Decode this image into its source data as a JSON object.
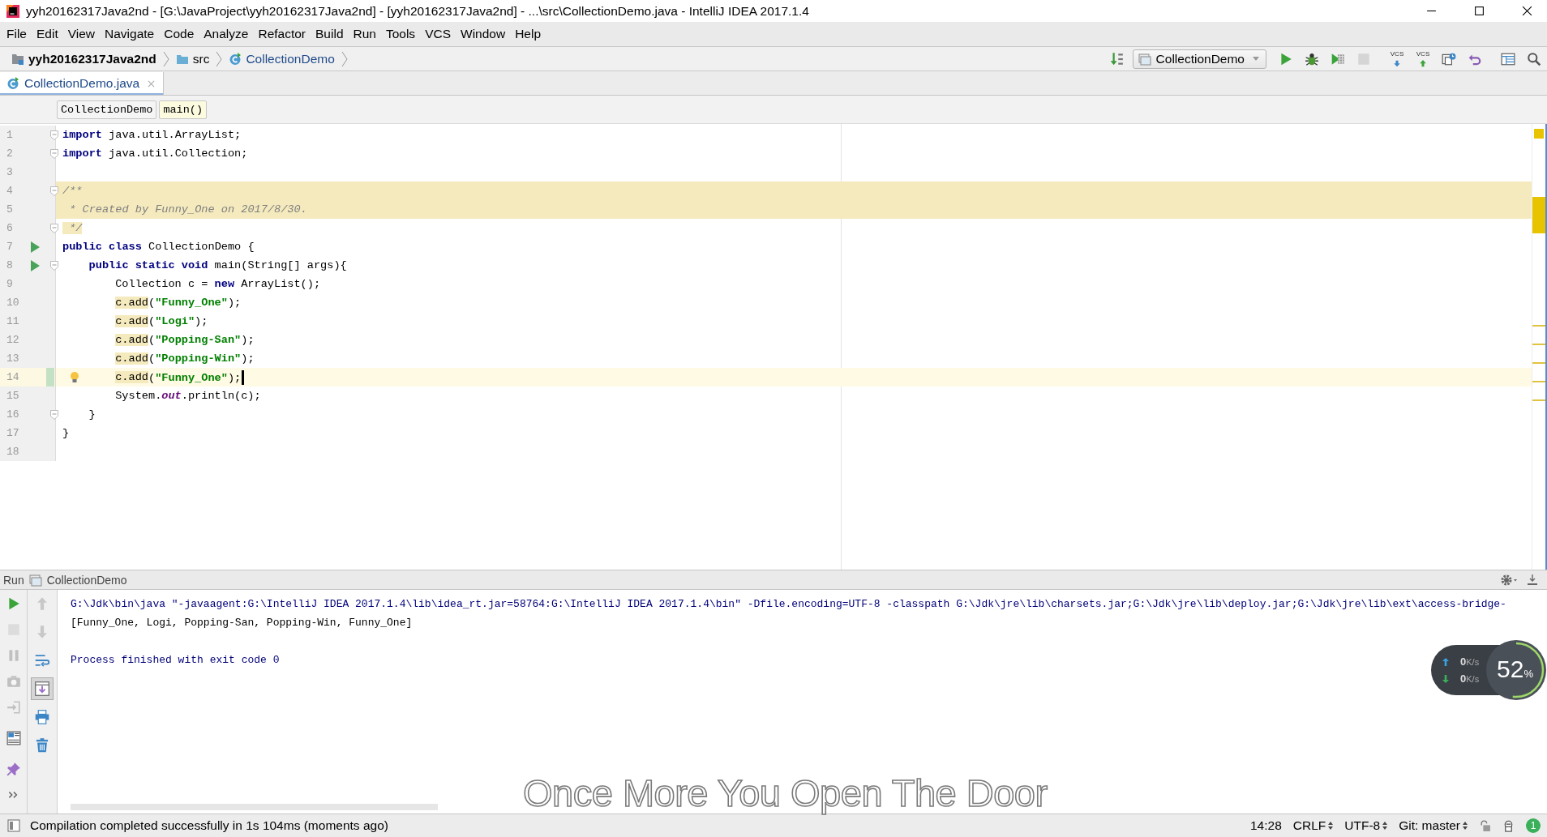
{
  "window": {
    "title": "yyh20162317Java2nd - [G:\\JavaProject\\yyh20162317Java2nd] - [yyh20162317Java2nd] - ...\\src\\CollectionDemo.java - IntelliJ IDEA 2017.1.4"
  },
  "menu": [
    "File",
    "Edit",
    "View",
    "Navigate",
    "Code",
    "Analyze",
    "Refactor",
    "Build",
    "Run",
    "Tools",
    "VCS",
    "Window",
    "Help"
  ],
  "navigation": {
    "crumbs": [
      {
        "kind": "module",
        "label": "yyh20162317Java2nd"
      },
      {
        "kind": "folder",
        "label": "src"
      },
      {
        "kind": "class",
        "label": "CollectionDemo"
      }
    ],
    "run_config": "CollectionDemo",
    "tools": [
      {
        "kind": "build",
        "disabled": false
      },
      {
        "kind": "run",
        "disabled": false
      },
      {
        "kind": "debug",
        "disabled": false
      },
      {
        "kind": "coverage",
        "disabled": false
      },
      {
        "kind": "stop",
        "disabled": true
      },
      {
        "kind": "vcs-update",
        "label": "VCS",
        "disabled": false
      },
      {
        "kind": "vcs-commit",
        "label": "VCS",
        "disabled": false
      },
      {
        "kind": "history",
        "disabled": false
      },
      {
        "kind": "revert",
        "disabled": false
      },
      {
        "kind": "structure",
        "disabled": false
      },
      {
        "kind": "search",
        "disabled": false
      }
    ]
  },
  "editor_tabs": [
    {
      "label": "CollectionDemo.java",
      "selected": true
    }
  ],
  "breadcrumbs": [
    {
      "label": "CollectionDemo",
      "selected": false
    },
    {
      "label": "main()",
      "selected": true
    }
  ],
  "code": [
    {
      "number": "1",
      "shaded": false,
      "current": false,
      "gutter": [
        {
          "kind": "fold"
        }
      ],
      "tokens": [
        {
          "kind": "kw",
          "text": "import"
        },
        {
          "kind": "plain",
          "text": " java.util.ArrayList;"
        }
      ]
    },
    {
      "number": "2",
      "shaded": false,
      "current": false,
      "gutter": [
        {
          "kind": "fold"
        }
      ],
      "tokens": [
        {
          "kind": "kw",
          "text": "import"
        },
        {
          "kind": "plain",
          "text": " java.util.Collection;"
        }
      ]
    },
    {
      "number": "3",
      "shaded": false,
      "current": false
    },
    {
      "number": "4",
      "shaded": true,
      "current": false,
      "gutter": [
        {
          "kind": "fold"
        }
      ],
      "tokens": [
        {
          "kind": "comment",
          "text": "/**"
        }
      ]
    },
    {
      "number": "5",
      "shaded": true,
      "current": false,
      "tokens": [
        {
          "kind": "comment",
          "text": " * Created by Funny_One on 2017/8/30."
        }
      ]
    },
    {
      "number": "6",
      "shaded": false,
      "current": false,
      "gutter": [
        {
          "kind": "fold"
        }
      ],
      "tokens": [
        {
          "kind": "comment",
          "text": " */"
        }
      ]
    },
    {
      "number": "7",
      "shaded": false,
      "current": false,
      "gutter": [
        {
          "kind": "run"
        }
      ],
      "tokens": [
        {
          "kind": "kw",
          "text": "public class"
        },
        {
          "kind": "plain",
          "text": " CollectionDemo {"
        }
      ],
      "children": [
        {
          "number": "8",
          "shaded": false,
          "current": false,
          "gutter": [
            {
              "kind": "run"
            },
            {
              "kind": "fold"
            }
          ],
          "tokens": [
            {
              "kind": "kw",
              "text": "public static void"
            },
            {
              "kind": "plain",
              "text": " main(String[] args){"
            }
          ],
          "children": [
            {
              "number": "9",
              "shaded": false,
              "current": false,
              "tokens": [
                {
                  "kind": "plain",
                  "text": "Collection c = "
                },
                {
                  "kind": "kw",
                  "text": "new"
                },
                {
                  "kind": "plain",
                  "text": " ArrayList();"
                }
              ]
            },
            {
              "number": "10",
              "shaded": false,
              "current": false,
              "tokens": [
                {
                  "kind": "usage",
                  "text": "c.add"
                },
                {
                  "kind": "plain",
                  "text": "("
                },
                {
                  "kind": "str",
                  "text": "\"Funny_One\""
                },
                {
                  "kind": "plain",
                  "text": ");"
                }
              ]
            },
            {
              "number": "11",
              "shaded": false,
              "current": false,
              "tokens": [
                {
                  "kind": "usage",
                  "text": "c.add"
                },
                {
                  "kind": "plain",
                  "text": "("
                },
                {
                  "kind": "str",
                  "text": "\"Logi\""
                },
                {
                  "kind": "plain",
                  "text": ");"
                }
              ]
            },
            {
              "number": "12",
              "shaded": false,
              "current": false,
              "tokens": [
                {
                  "kind": "usage",
                  "text": "c.add"
                },
                {
                  "kind": "plain",
                  "text": "("
                },
                {
                  "kind": "str",
                  "text": "\"Popping-San\""
                },
                {
                  "kind": "plain",
                  "text": ");"
                }
              ]
            },
            {
              "number": "13",
              "shaded": false,
              "current": false,
              "tokens": [
                {
                  "kind": "usage",
                  "text": "c.add"
                },
                {
                  "kind": "plain",
                  "text": "("
                },
                {
                  "kind": "str",
                  "text": "\"Popping-Win\""
                },
                {
                  "kind": "plain",
                  "text": ");"
                }
              ]
            },
            {
              "number": "14",
              "shaded": false,
              "current": true,
              "gutter": [
                {
                  "kind": "changed"
                },
                {
                  "kind": "bulb"
                }
              ],
              "tokens": [
                {
                  "kind": "usage",
                  "text": "c.add"
                },
                {
                  "kind": "plain",
                  "text": "("
                },
                {
                  "kind": "str",
                  "text": "\"Funny_One\""
                },
                {
                  "kind": "plain",
                  "text": ");"
                }
              ]
            },
            {
              "number": "15",
              "shaded": false,
              "current": false,
              "tokens": [
                {
                  "kind": "plain",
                  "text": "System."
                },
                {
                  "kind": "field",
                  "text": "out"
                },
                {
                  "kind": "plain",
                  "text": ".println(c);"
                }
              ]
            }
          ]
        },
        {
          "number": "16",
          "shaded": false,
          "current": false,
          "gutter": [
            {
              "kind": "fold"
            }
          ],
          "tokens": [
            {
              "kind": "plain",
              "text": "}"
            }
          ]
        }
      ]
    },
    {
      "number": "17",
      "shaded": false,
      "current": false,
      "tokens": [
        {
          "kind": "plain",
          "text": "}"
        }
      ]
    },
    {
      "number": "18",
      "shaded": false,
      "current": false
    }
  ],
  "run_panel": {
    "label": "Run",
    "tab": "CollectionDemo",
    "left_tools": [
      {
        "kind": "rerun",
        "disabled": false
      },
      {
        "kind": "stop",
        "disabled": true
      },
      {
        "kind": "pause",
        "disabled": true
      },
      {
        "kind": "dump",
        "disabled": true
      },
      {
        "kind": "exit",
        "disabled": true
      },
      {
        "kind": "layout",
        "disabled": false
      },
      {
        "kind": "pin",
        "disabled": false
      },
      {
        "kind": "more",
        "disabled": false
      }
    ],
    "right_tools": [
      {
        "kind": "up",
        "disabled": true,
        "pressed": false
      },
      {
        "kind": "down",
        "disabled": true,
        "pressed": false
      },
      {
        "kind": "wrap",
        "disabled": false,
        "pressed": false
      },
      {
        "kind": "scroll-end",
        "disabled": false,
        "pressed": true
      },
      {
        "kind": "print",
        "disabled": false,
        "pressed": false
      },
      {
        "kind": "trash",
        "disabled": false,
        "pressed": false
      }
    ],
    "console": [
      {
        "kind": "system",
        "text": "G:\\Jdk\\bin\\java \"-javaagent:G:\\IntelliJ IDEA 2017.1.4\\lib\\idea_rt.jar=58764:G:\\IntelliJ IDEA 2017.1.4\\bin\" -Dfile.encoding=UTF-8 -classpath G:\\Jdk\\jre\\lib\\charsets.jar;G:\\Jdk\\jre\\lib\\deploy.jar;G:\\Jdk\\jre\\lib\\ext\\access-bridge-"
      },
      {
        "kind": "output",
        "text": "[Funny_One, Logi, Popping-San, Popping-Win, Funny_One]"
      },
      {
        "kind": "blank"
      },
      {
        "kind": "system",
        "text": "Process finished with exit code 0"
      }
    ]
  },
  "lyrics": "Once More You Open The Door",
  "net_monitor": {
    "upload": {
      "value": "0",
      "unit": "K/s"
    },
    "download": {
      "value": "0",
      "unit": "K/s"
    },
    "percent": "52",
    "percent_sign": "%",
    "level": 0.52
  },
  "status_bar": {
    "message": "Compilation completed successfully in 1s 104ms (moments ago)",
    "position": "14:28",
    "line_separator": "CRLF",
    "encoding": "UTF-8",
    "vcs": "Git: master",
    "notifications": "1"
  }
}
